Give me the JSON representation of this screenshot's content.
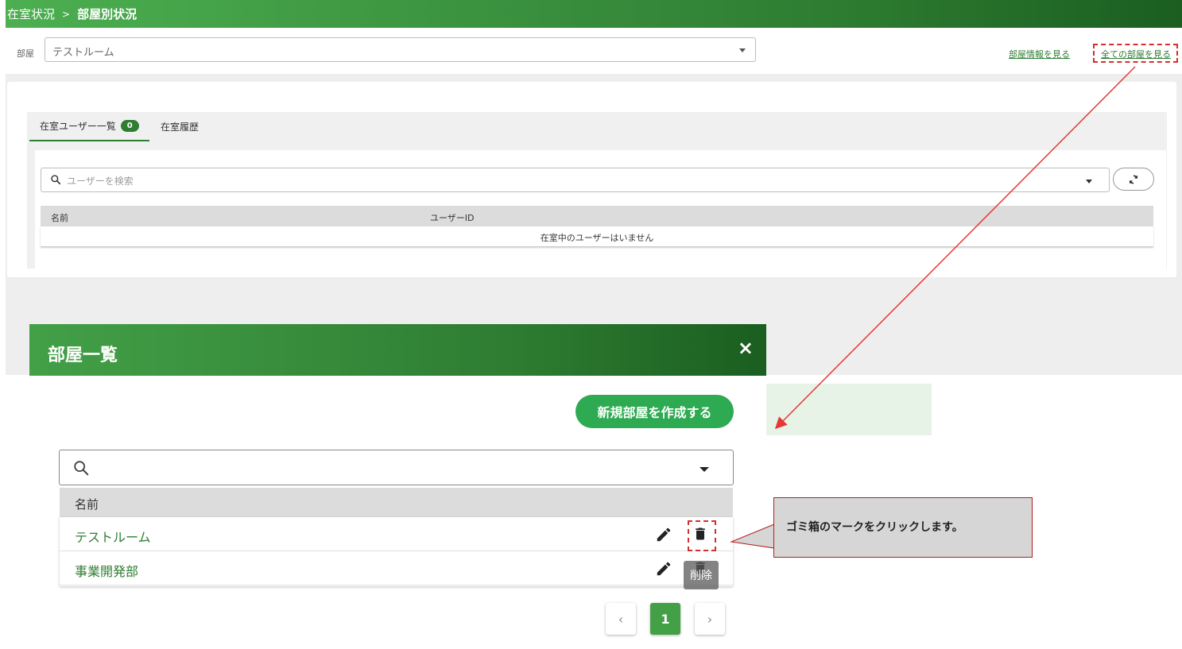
{
  "breadcrumb": {
    "root": "在室状況",
    "separator": ">",
    "current": "部屋別状況"
  },
  "room_select": {
    "label": "部屋",
    "value": "テストルーム"
  },
  "header_links": {
    "room_info": "部屋情報を見る",
    "all_rooms": "全ての部屋を見る"
  },
  "tabs": [
    {
      "label": "在室ユーザー一覧",
      "badge": "0"
    },
    {
      "label": "在室履歴"
    }
  ],
  "user_search": {
    "placeholder": "ユーザーを検索"
  },
  "user_table": {
    "columns": [
      "名前",
      "ユーザーID"
    ],
    "empty_message": "在室中のユーザーはいません"
  },
  "modal": {
    "title": "部屋一覧",
    "close_glyph": "×",
    "create_button": "新規部屋を作成する",
    "list_header": "名前",
    "rooms": [
      "テストルーム",
      "事業開発部"
    ],
    "tooltip": "削除",
    "pagination": {
      "prev": "‹",
      "current": "1",
      "next": "›"
    }
  },
  "callout": {
    "text": "ゴミ箱のマークをクリックします。"
  },
  "colors": {
    "brand_green": "#2e7d32",
    "button_green": "#2eaa52",
    "annotation_red": "#d32f2f"
  },
  "icons": [
    "search-icon",
    "caret-down-icon",
    "refresh-icon",
    "close-icon",
    "pencil-icon",
    "trash-icon",
    "chevron-left-icon",
    "chevron-right-icon"
  ]
}
